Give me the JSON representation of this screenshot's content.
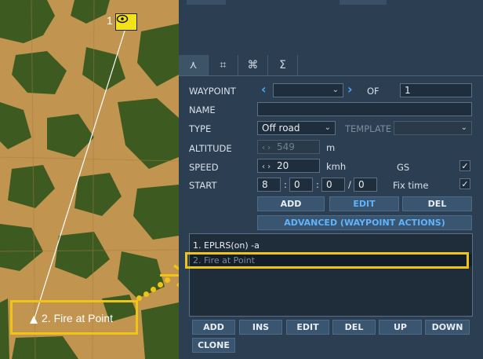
{
  "map": {
    "waypoint_1": {
      "number": "1"
    },
    "waypoint_2": {
      "label": "2. Fire at Point"
    }
  },
  "tabs": [
    {
      "name": "route",
      "icon": "route-icon",
      "glyph": "⋏"
    },
    {
      "name": "triggers",
      "icon": "target-icon",
      "glyph": "⌗"
    },
    {
      "name": "actions",
      "icon": "command-icon",
      "glyph": "⌘"
    },
    {
      "name": "summary",
      "icon": "sigma-icon",
      "glyph": "Σ"
    }
  ],
  "waypoint": {
    "label": "WAYPOINT",
    "value": "",
    "of_label": "OF",
    "total": "1"
  },
  "name": {
    "label": "NAME",
    "value": ""
  },
  "type": {
    "label": "TYPE",
    "value": "Off road",
    "template_label": "TEMPLATE",
    "template_value": ""
  },
  "altitude": {
    "label": "ALTITUDE",
    "value": "549",
    "unit": "m"
  },
  "speed": {
    "label": "SPEED",
    "value": "20",
    "unit": "kmh",
    "gs_label": "GS",
    "gs_checked": true
  },
  "start": {
    "label": "START",
    "h": "8",
    "m": "0",
    "s": "0",
    "d": "0",
    "fix_label": "Fix time",
    "fix_checked": true
  },
  "buttons": {
    "add": "ADD",
    "edit": "EDIT",
    "del": "DEL",
    "advanced": "ADVANCED (WAYPOINT ACTIONS)"
  },
  "actions_list": [
    {
      "text": "1. EPLRS(on)  -a"
    },
    {
      "text": "2. Fire at Point"
    }
  ],
  "bottom_buttons": {
    "add": "ADD",
    "ins": "INS",
    "edit": "EDIT",
    "del": "DEL",
    "up": "UP",
    "down": "DOWN",
    "clone": "CLONE"
  },
  "colors": {
    "highlight": "#f0c414",
    "accent": "#4aa7ff",
    "panel": "#2c3f52",
    "terrain": "#c1954f",
    "forest": "#3d5a20"
  }
}
